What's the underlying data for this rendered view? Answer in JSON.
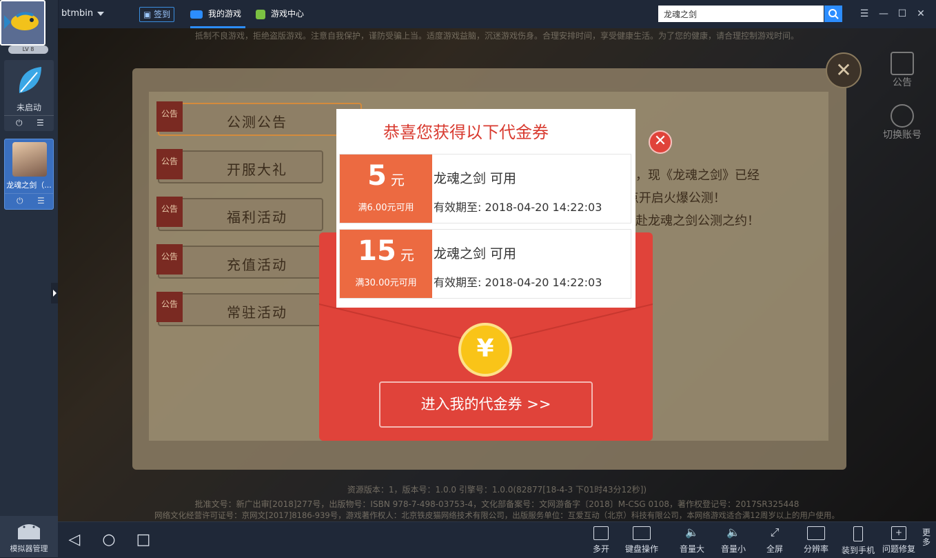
{
  "topbar": {
    "username": "btmbin",
    "checkin_label": "签到",
    "tabs": [
      {
        "label": "我的游戏"
      },
      {
        "label": "游戏中心"
      }
    ],
    "search_value": "龙魂之剑",
    "colors": {
      "accent": "#2c8dff"
    }
  },
  "sidebar": {
    "level": "LV 8",
    "apps": [
      {
        "label": "未启动"
      },
      {
        "label": "龙魂之剑（..."
      }
    ],
    "emulator_manager": "模拟器管理"
  },
  "game": {
    "notice_top": "抵制不良游戏，拒绝盗版游戏。注意自我保护，谨防受骗上当。适度游戏益脑，沉迷游戏伤身。合理安排时间，享受健康生活。为了您的健康，请合理控制游戏时间。",
    "menu_tag": "公告",
    "menu_items": [
      {
        "label": "公测公告"
      },
      {
        "label": "开服大礼"
      },
      {
        "label": "福利活动"
      },
      {
        "label": "充值活动"
      },
      {
        "label": "常驻活动"
      }
    ],
    "announce_lines": [
      "享爱，现《龙魂之剑》已经",
      "10点开启火爆公测！",
      "士，赴龙魂之剑公测之约！"
    ],
    "right_tools": [
      {
        "label": "公告"
      },
      {
        "label": "切换账号"
      }
    ],
    "footer_lines": [
      "资源版本：1，版本号：1.0.0 引擎号：1.0.0(82877[18-4-3 下01时43分12秒])",
      "批准文号：新广出审[2018]277号，出版物号：ISBN 978-7-498-03753-4，文化部备案号：文网游备字〔2018〕M-CSG 0108，著作权登记号：2017SR325448",
      "网络文化经营许可证号：京网文[2017]8186-939号，游戏著作权人：北京铁皮猫网络技术有限公司，出版服务单位：互爱互动（北京）科技有限公司，本网络游戏适合满12周岁以上的用户使用。"
    ]
  },
  "coupon_popup": {
    "title": "恭喜您获得以下代金券",
    "coupons": [
      {
        "amount": "5",
        "unit": "元",
        "condition": "满6.00元可用",
        "name": "龙魂之剑 可用",
        "valid": "有效期至: 2018-04-20 14:22:03"
      },
      {
        "amount": "15",
        "unit": "元",
        "condition": "满30.00元可用",
        "name": "龙魂之剑 可用",
        "valid": "有效期至: 2018-04-20 14:22:03"
      }
    ],
    "coin_symbol": "¥",
    "enter_button": "进入我的代金券 >>",
    "colors": {
      "red": "#e0433a",
      "orange": "#ec6a41"
    }
  },
  "bottombar": {
    "tools": [
      {
        "label": "多开"
      },
      {
        "label": "键盘操作"
      },
      {
        "label": "音量大"
      },
      {
        "label": "音量小"
      },
      {
        "label": "全屏"
      },
      {
        "label": "分辨率"
      },
      {
        "label": "装到手机"
      },
      {
        "label": "问题修复"
      }
    ],
    "more": "更多"
  }
}
